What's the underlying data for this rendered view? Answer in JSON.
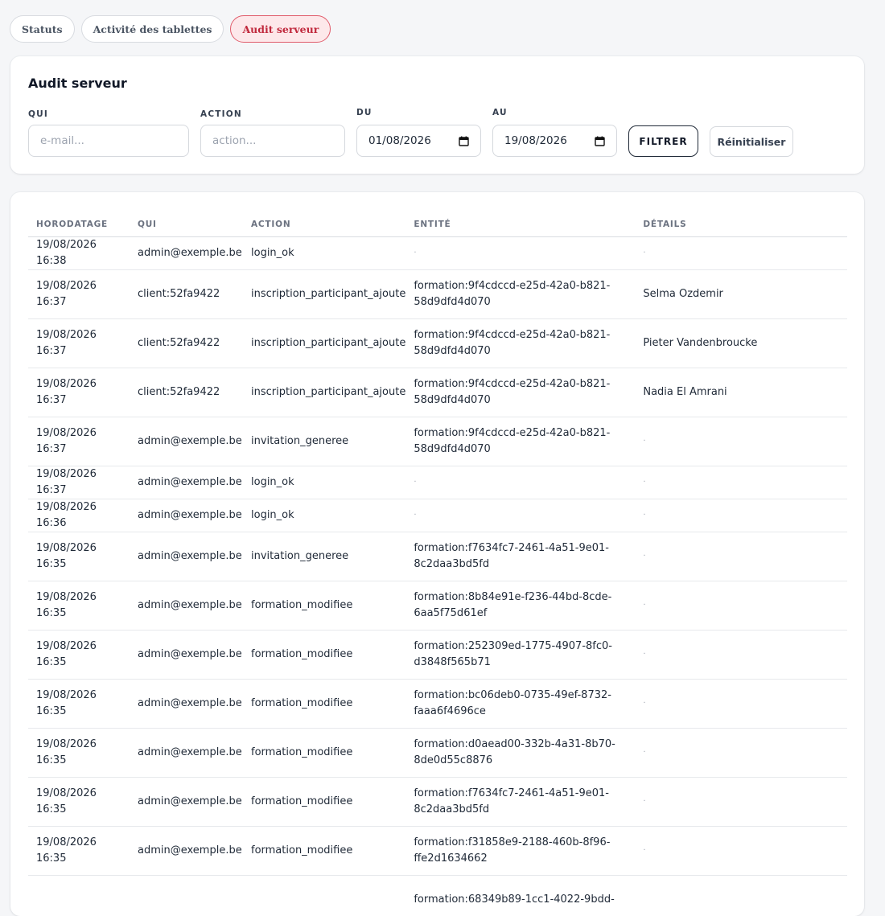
{
  "tabs": [
    {
      "label": "Statuts",
      "active": false
    },
    {
      "label": "Activité des tablettes",
      "active": false
    },
    {
      "label": "Audit serveur",
      "active": true
    }
  ],
  "filters": {
    "title": "Audit serveur",
    "qui_label": "QUI",
    "qui_placeholder": "e-mail...",
    "action_label": "ACTION",
    "action_placeholder": "action...",
    "du_label": "DU",
    "du_value": "01/08/2026",
    "au_label": "AU",
    "au_value": "19/08/2026",
    "filter_button": "FILTRER",
    "reset_button": "Réinitialiser"
  },
  "table": {
    "columns": [
      "HORODATAGE",
      "QUI",
      "ACTION",
      "ENTITÉ",
      "DÉTAILS"
    ],
    "rows": [
      {
        "ts": "19/08/2026 16:38",
        "qui": "admin@exemple.be",
        "action": "login_ok",
        "entite": "·",
        "details": "·"
      },
      {
        "ts": "19/08/2026 16:37",
        "qui": "client:52fa9422",
        "action": "inscription_participant_ajoute",
        "entite": "formation:9f4cdccd-e25d-42a0-b821-58d9dfd4d070",
        "details": "Selma Ozdemir"
      },
      {
        "ts": "19/08/2026 16:37",
        "qui": "client:52fa9422",
        "action": "inscription_participant_ajoute",
        "entite": "formation:9f4cdccd-e25d-42a0-b821-58d9dfd4d070",
        "details": "Pieter Vandenbroucke"
      },
      {
        "ts": "19/08/2026 16:37",
        "qui": "client:52fa9422",
        "action": "inscription_participant_ajoute",
        "entite": "formation:9f4cdccd-e25d-42a0-b821-58d9dfd4d070",
        "details": "Nadia El Amrani"
      },
      {
        "ts": "19/08/2026 16:37",
        "qui": "admin@exemple.be",
        "action": "invitation_generee",
        "entite": "formation:9f4cdccd-e25d-42a0-b821-58d9dfd4d070",
        "details": "·"
      },
      {
        "ts": "19/08/2026 16:37",
        "qui": "admin@exemple.be",
        "action": "login_ok",
        "entite": "·",
        "details": "·"
      },
      {
        "ts": "19/08/2026 16:36",
        "qui": "admin@exemple.be",
        "action": "login_ok",
        "entite": "·",
        "details": "·"
      },
      {
        "ts": "19/08/2026 16:35",
        "qui": "admin@exemple.be",
        "action": "invitation_generee",
        "entite": "formation:f7634fc7-2461-4a51-9e01-8c2daa3bd5fd",
        "details": "·"
      },
      {
        "ts": "19/08/2026 16:35",
        "qui": "admin@exemple.be",
        "action": "formation_modifiee",
        "entite": "formation:8b84e91e-f236-44bd-8cde-6aa5f75d61ef",
        "details": "·"
      },
      {
        "ts": "19/08/2026 16:35",
        "qui": "admin@exemple.be",
        "action": "formation_modifiee",
        "entite": "formation:252309ed-1775-4907-8fc0-d3848f565b71",
        "details": "·"
      },
      {
        "ts": "19/08/2026 16:35",
        "qui": "admin@exemple.be",
        "action": "formation_modifiee",
        "entite": "formation:bc06deb0-0735-49ef-8732-faaa6f4696ce",
        "details": "·"
      },
      {
        "ts": "19/08/2026 16:35",
        "qui": "admin@exemple.be",
        "action": "formation_modifiee",
        "entite": "formation:d0aead00-332b-4a31-8b70-8de0d55c8876",
        "details": "·"
      },
      {
        "ts": "19/08/2026 16:35",
        "qui": "admin@exemple.be",
        "action": "formation_modifiee",
        "entite": "formation:f7634fc7-2461-4a51-9e01-8c2daa3bd5fd",
        "details": "·"
      },
      {
        "ts": "19/08/2026 16:35",
        "qui": "admin@exemple.be",
        "action": "formation_modifiee",
        "entite": "formation:f31858e9-2188-460b-8f96-ffe2d1634662",
        "details": "·"
      },
      {
        "ts": "",
        "qui": "",
        "action": "",
        "entite": "formation:68349b89-1cc1-4022-9bdd-",
        "details": ""
      }
    ]
  }
}
